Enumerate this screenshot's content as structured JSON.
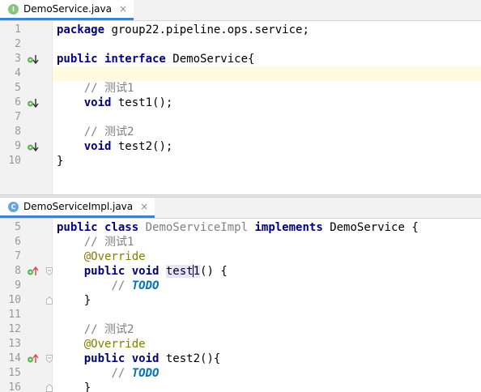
{
  "editor_top": {
    "tab": {
      "label": "DemoService.java",
      "icon": "interface-file-icon",
      "icon_letter": "I",
      "close": "×"
    },
    "lines": [
      {
        "n": "1",
        "tokens": [
          [
            "kw",
            "package"
          ],
          [
            "p",
            " group22.pipeline.ops.service;"
          ]
        ]
      },
      {
        "n": "2",
        "tokens": []
      },
      {
        "n": "3",
        "icon": "implemented-down",
        "tokens": [
          [
            "kw",
            "public interface"
          ],
          [
            "p",
            " DemoService{"
          ]
        ]
      },
      {
        "n": "4",
        "current": true,
        "tokens": []
      },
      {
        "n": "5",
        "tokens": [
          [
            "p",
            "    "
          ],
          [
            "cm",
            "// 测试1"
          ]
        ]
      },
      {
        "n": "6",
        "icon": "implemented-down",
        "tokens": [
          [
            "p",
            "    "
          ],
          [
            "kw",
            "void"
          ],
          [
            "p",
            " test1();"
          ]
        ]
      },
      {
        "n": "7",
        "tokens": []
      },
      {
        "n": "8",
        "tokens": [
          [
            "p",
            "    "
          ],
          [
            "cm",
            "// 测试2"
          ]
        ]
      },
      {
        "n": "9",
        "icon": "implemented-down",
        "tokens": [
          [
            "p",
            "    "
          ],
          [
            "kw",
            "void"
          ],
          [
            "p",
            " test2();"
          ]
        ]
      },
      {
        "n": "10",
        "tokens": [
          [
            "p",
            "}"
          ]
        ]
      }
    ]
  },
  "editor_bottom": {
    "tab": {
      "label": "DemoServiceImpl.java",
      "icon": "class-file-icon",
      "icon_letter": "C",
      "close": "×"
    },
    "lines": [
      {
        "n": "5",
        "tokens": [
          [
            "kw",
            "public class"
          ],
          [
            "p",
            " "
          ],
          [
            "unused",
            "DemoServiceImpl"
          ],
          [
            "p",
            " "
          ],
          [
            "kw",
            "implements"
          ],
          [
            "p",
            " DemoService {"
          ]
        ]
      },
      {
        "n": "6",
        "tokens": [
          [
            "p",
            "    "
          ],
          [
            "cm",
            "// 测试1"
          ]
        ]
      },
      {
        "n": "7",
        "tokens": [
          [
            "p",
            "    "
          ],
          [
            "an",
            "@Override"
          ]
        ]
      },
      {
        "n": "8",
        "icon": "implements-up",
        "fold": "open",
        "tokens": [
          [
            "p",
            "    "
          ],
          [
            "kw",
            "public void"
          ],
          [
            "p",
            " "
          ],
          [
            "hl",
            "test"
          ],
          [
            "caret",
            ""
          ],
          [
            "hl",
            "1"
          ],
          [
            "p",
            "() {"
          ]
        ]
      },
      {
        "n": "9",
        "tokens": [
          [
            "p",
            "        "
          ],
          [
            "cm",
            "// "
          ],
          [
            "todo",
            "TODO"
          ]
        ]
      },
      {
        "n": "10",
        "fold": "close",
        "tokens": [
          [
            "p",
            "    }"
          ]
        ]
      },
      {
        "n": "11",
        "tokens": []
      },
      {
        "n": "12",
        "tokens": [
          [
            "p",
            "    "
          ],
          [
            "cm",
            "// 测试2"
          ]
        ]
      },
      {
        "n": "13",
        "tokens": [
          [
            "p",
            "    "
          ],
          [
            "an",
            "@Override"
          ]
        ]
      },
      {
        "n": "14",
        "icon": "implements-up",
        "fold": "open",
        "tokens": [
          [
            "p",
            "    "
          ],
          [
            "kw",
            "public void"
          ],
          [
            "p",
            " test2(){"
          ]
        ]
      },
      {
        "n": "15",
        "tokens": [
          [
            "p",
            "        "
          ],
          [
            "cm",
            "// "
          ],
          [
            "todo",
            "TODO"
          ]
        ]
      },
      {
        "n": "16",
        "fold": "close",
        "tokens": [
          [
            "p",
            "    }"
          ]
        ]
      }
    ]
  }
}
